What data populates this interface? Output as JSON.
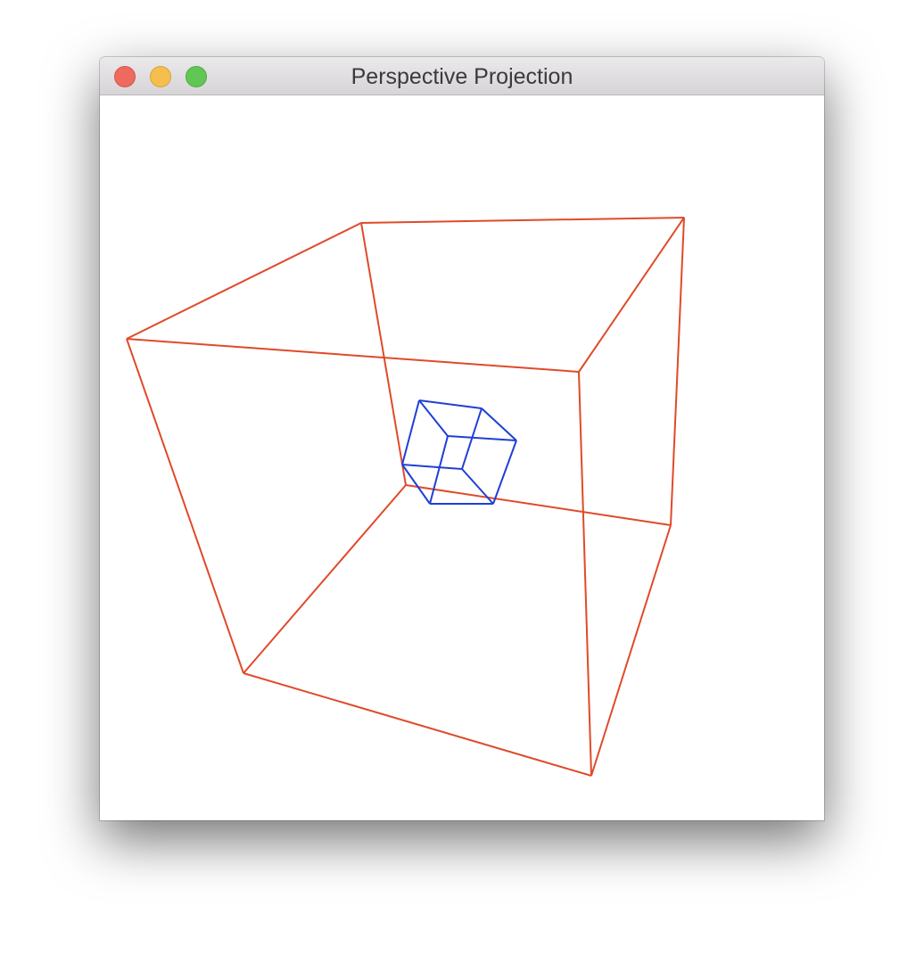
{
  "window": {
    "title": "Perspective Projection",
    "controls": {
      "close": {
        "icon": "close-icon",
        "color": "#ee6a5f"
      },
      "minimize": {
        "icon": "minimize-icon",
        "color": "#f5be4f"
      },
      "zoom": {
        "icon": "zoom-icon",
        "color": "#62c654"
      }
    }
  },
  "scene": {
    "cubes": [
      {
        "name": "outer-cube",
        "color": "#e04a2a"
      },
      {
        "name": "inner-cube",
        "color": "#1f3fd6"
      }
    ]
  }
}
